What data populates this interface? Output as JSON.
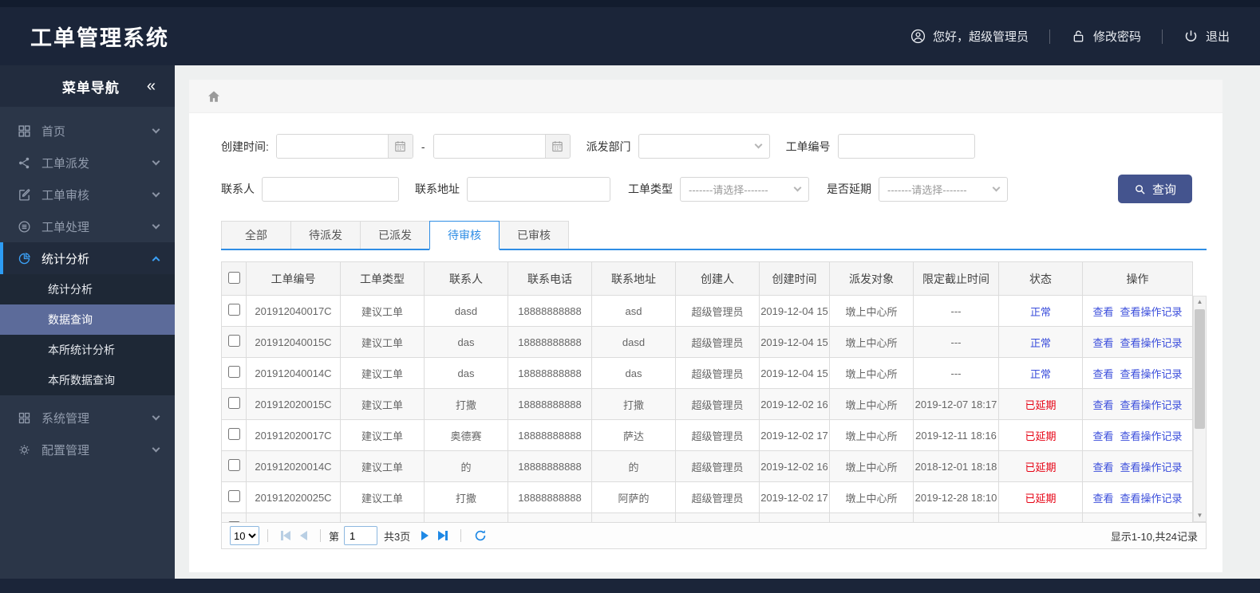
{
  "app": {
    "title": "工单管理系统"
  },
  "topbar": {
    "greeting": "您好，超级管理员",
    "change_password": "修改密码",
    "logout": "退出",
    "icons": [
      "user-circle-icon",
      "lock-icon",
      "power-icon"
    ]
  },
  "sidebar": {
    "title": "菜单导航",
    "collapse_glyph": "«",
    "items": [
      {
        "label": "首页",
        "icon": "dashboard-grid-icon"
      },
      {
        "label": "工单派发",
        "icon": "share-icon"
      },
      {
        "label": "工单审核",
        "icon": "edit-icon"
      },
      {
        "label": "工单处理",
        "icon": "process-circle-icon"
      },
      {
        "label": "统计分析",
        "icon": "pie-chart-icon"
      },
      {
        "label": "系统管理",
        "icon": "system-grid-icon"
      },
      {
        "label": "配置管理",
        "icon": "gear-icon"
      }
    ],
    "submenu": {
      "parent": "统计分析",
      "items": [
        "统计分析",
        "数据查询",
        "本所统计分析",
        "本所数据查询"
      ],
      "active": "数据查询"
    }
  },
  "breadcrumb": {
    "home_icon": "home-icon"
  },
  "filters": {
    "create_time_label": "创建时间:",
    "date_separator": "-",
    "create_time_start": "",
    "create_time_end": "",
    "dispatch_dept_label": "派发部门",
    "dispatch_dept_value": "",
    "order_no_label": "工单编号",
    "order_no_value": "",
    "contact_label": "联系人",
    "contact_value": "",
    "address_label": "联系地址",
    "address_value": "",
    "order_type_label": "工单类型",
    "delay_label": "是否延期",
    "select_placeholder": "-------请选择-------",
    "search_button": "查询"
  },
  "tabs": [
    {
      "label": "全部",
      "active": false
    },
    {
      "label": "待派发",
      "active": false
    },
    {
      "label": "已派发",
      "active": false
    },
    {
      "label": "待审核",
      "active": true
    },
    {
      "label": "已审核",
      "active": false
    }
  ],
  "table": {
    "headers": [
      "工单编号",
      "工单类型",
      "联系人",
      "联系电话",
      "联系地址",
      "创建人",
      "创建时间",
      "派发对象",
      "限定截止时间",
      "状态",
      "操作"
    ],
    "action_labels": [
      "查看",
      "查看操作记录"
    ],
    "status_colors": {
      "normal": "#3a4ddb",
      "delayed": "#e60012"
    },
    "rows": [
      {
        "order_no": "201912040017C",
        "type": "建议工单",
        "contact": "dasd",
        "phone": "18888888888",
        "address": "asd",
        "creator": "超级管理员",
        "created": "2019-12-04 15",
        "target": "墩上中心所",
        "deadline": "---",
        "status": "正常"
      },
      {
        "order_no": "201912040015C",
        "type": "建议工单",
        "contact": "das",
        "phone": "18888888888",
        "address": "dasd",
        "creator": "超级管理员",
        "created": "2019-12-04 15",
        "target": "墩上中心所",
        "deadline": "---",
        "status": "正常"
      },
      {
        "order_no": "201912040014C",
        "type": "建议工单",
        "contact": "das",
        "phone": "18888888888",
        "address": "das",
        "creator": "超级管理员",
        "created": "2019-12-04 15",
        "target": "墩上中心所",
        "deadline": "---",
        "status": "正常"
      },
      {
        "order_no": "201912020015C",
        "type": "建议工单",
        "contact": "打撒",
        "phone": "18888888888",
        "address": "打撒",
        "creator": "超级管理员",
        "created": "2019-12-02 16",
        "target": "墩上中心所",
        "deadline": "2019-12-07 18:17",
        "status": "已延期"
      },
      {
        "order_no": "201912020017C",
        "type": "建议工单",
        "contact": "奥德赛",
        "phone": "18888888888",
        "address": "萨达",
        "creator": "超级管理员",
        "created": "2019-12-02 17",
        "target": "墩上中心所",
        "deadline": "2019-12-11 18:16",
        "status": "已延期"
      },
      {
        "order_no": "201912020014C",
        "type": "建议工单",
        "contact": "的",
        "phone": "18888888888",
        "address": "的",
        "creator": "超级管理员",
        "created": "2019-12-02 16",
        "target": "墩上中心所",
        "deadline": "2018-12-01 18:18",
        "status": "已延期"
      },
      {
        "order_no": "201912020025C",
        "type": "建议工单",
        "contact": "打撒",
        "phone": "18888888888",
        "address": "阿萨的",
        "creator": "超级管理员",
        "created": "2019-12-02 17",
        "target": "墩上中心所",
        "deadline": "2019-12-28 18:10",
        "status": "已延期"
      }
    ]
  },
  "pagination": {
    "page_size": "10",
    "page_prefix": "第",
    "page_value": "1",
    "total_pages": "共3页",
    "info": "显示1-10,共24记录"
  }
}
